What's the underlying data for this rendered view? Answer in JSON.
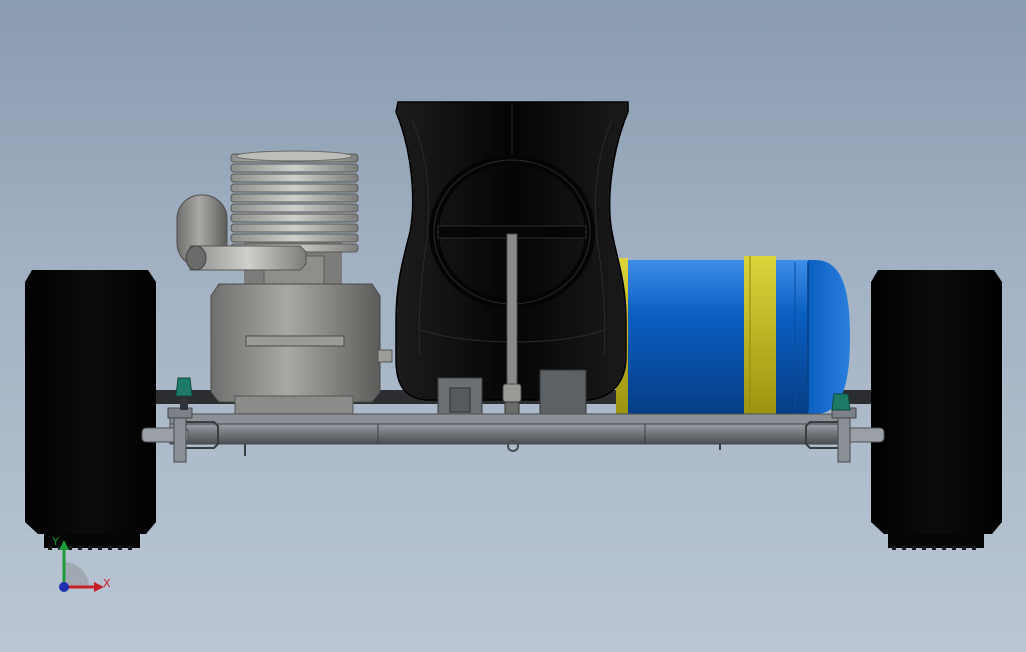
{
  "viewport": {
    "background_top": "#8a9bb0",
    "background_bottom": "#bac6d4"
  },
  "triad": {
    "x_label": "X",
    "y_label": "Y",
    "x_color": "#c8202a",
    "y_color": "#1d9a3a",
    "z_color": "#1f2fb0"
  },
  "model": {
    "tank_color": "#0a5fc2",
    "tank_band_color": "#c9c21a",
    "tire_color": "#050505",
    "seat_color": "#0d0d0d",
    "engine_color": "#8a8a88",
    "frame_color": "#6e7378"
  }
}
